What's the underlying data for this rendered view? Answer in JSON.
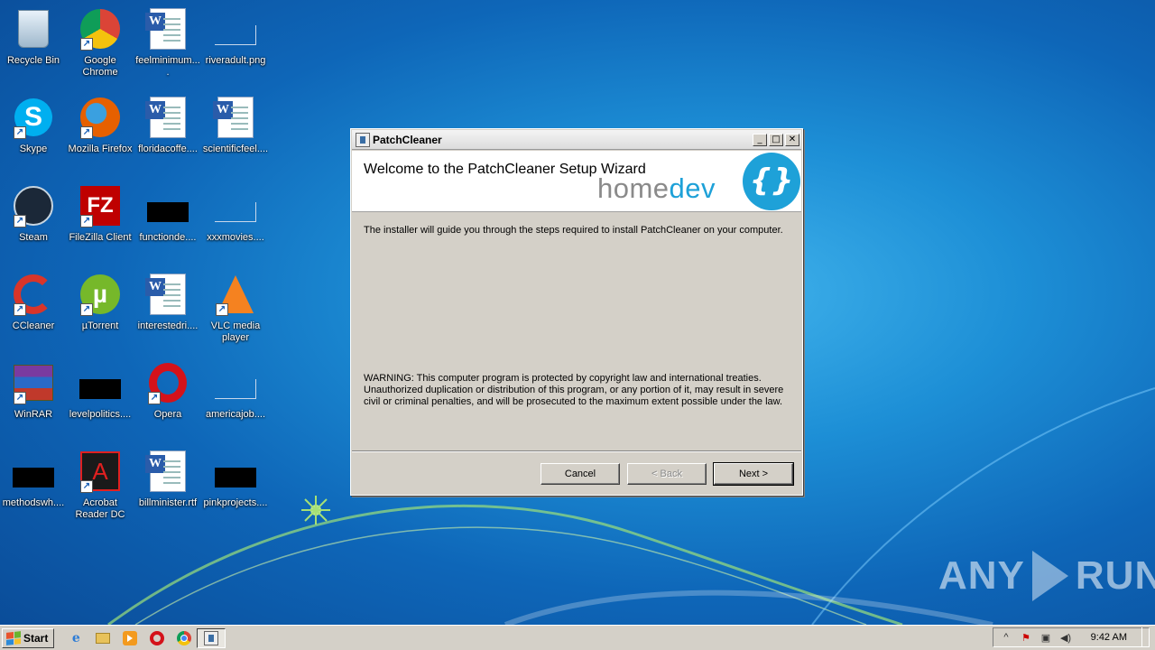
{
  "desktop": {
    "icons": [
      {
        "label": "Recycle Bin",
        "icon": "recycle-bin-icon",
        "shortcut": false
      },
      {
        "label": "Google Chrome",
        "icon": "chrome-icon",
        "shortcut": true
      },
      {
        "label": "feelminimum....",
        "icon": "word-doc-icon",
        "shortcut": false
      },
      {
        "label": "riveradult.png",
        "icon": "image-file-icon",
        "shortcut": false
      },
      {
        "label": "Skype",
        "icon": "skype-icon",
        "shortcut": true
      },
      {
        "label": "Mozilla Firefox",
        "icon": "firefox-icon",
        "shortcut": true
      },
      {
        "label": "floridacoffe....",
        "icon": "word-doc-icon",
        "shortcut": false
      },
      {
        "label": "scientificfeel....",
        "icon": "word-doc-icon",
        "shortcut": false
      },
      {
        "label": "Steam",
        "icon": "steam-icon",
        "shortcut": true
      },
      {
        "label": "FileZilla Client",
        "icon": "filezilla-icon",
        "shortcut": true
      },
      {
        "label": "functionde....",
        "icon": "black-file-icon",
        "shortcut": false
      },
      {
        "label": "xxxmovies....",
        "icon": "image-file-icon",
        "shortcut": false
      },
      {
        "label": "CCleaner",
        "icon": "ccleaner-icon",
        "shortcut": true
      },
      {
        "label": "µTorrent",
        "icon": "utorrent-icon",
        "shortcut": true
      },
      {
        "label": "interestedri....",
        "icon": "word-doc-icon",
        "shortcut": false
      },
      {
        "label": "VLC media player",
        "icon": "vlc-icon",
        "shortcut": true
      },
      {
        "label": "WinRAR",
        "icon": "winrar-icon",
        "shortcut": true
      },
      {
        "label": "levelpolitics....",
        "icon": "black-file-icon",
        "shortcut": false
      },
      {
        "label": "Opera",
        "icon": "opera-icon",
        "shortcut": true
      },
      {
        "label": "americajob....",
        "icon": "image-file-icon",
        "shortcut": false
      },
      {
        "label": "methodswh....",
        "icon": "black-file-icon",
        "shortcut": false
      },
      {
        "label": "Acrobat Reader DC",
        "icon": "acrobat-icon",
        "shortcut": true
      },
      {
        "label": "billminister.rtf",
        "icon": "word-doc-icon",
        "shortcut": false
      },
      {
        "label": "pinkprojects....",
        "icon": "black-file-icon",
        "shortcut": false
      }
    ]
  },
  "dialog": {
    "title": "PatchCleaner",
    "heading": "Welcome to the PatchCleaner Setup Wizard",
    "logo_home": "home",
    "logo_dev": "dev",
    "logo_mark": "{}",
    "intro": "The installer will guide you through the steps required to install PatchCleaner on your computer.",
    "warning": "WARNING: This computer program is protected by copyright law and international treaties. Unauthorized duplication or distribution of this program, or any portion of it, may result in severe civil or criminal penalties, and will be prosecuted to the maximum extent possible under the law.",
    "buttons": {
      "cancel": "Cancel",
      "back": "< Back",
      "next": "Next >"
    },
    "window_controls": {
      "minimize": "_",
      "maximize": "□",
      "close": "✕"
    }
  },
  "taskbar": {
    "start_label": "Start",
    "clock": "9:42 AM",
    "tray_expand": "^"
  },
  "watermark": {
    "left": "ANY",
    "right": "RUN"
  },
  "colors": {
    "accent": "#1ea1d8",
    "dialog_bg": "#d4d0c8"
  }
}
